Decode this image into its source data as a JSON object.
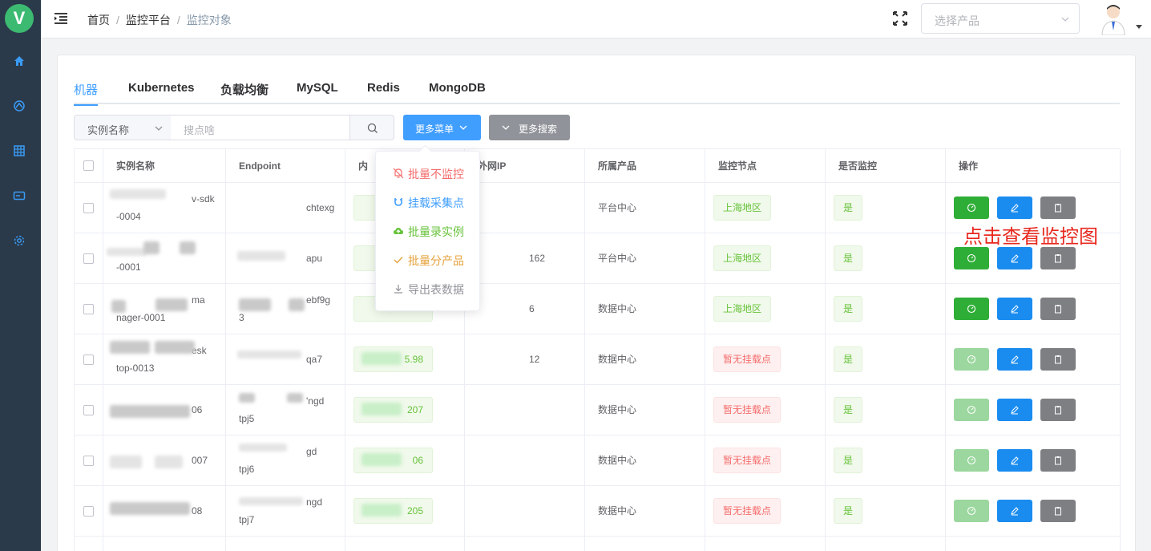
{
  "logo": {
    "letter": "V"
  },
  "breadcrumb": [
    "首页",
    "监控平台",
    "监控对象"
  ],
  "product_select": {
    "placeholder": "选择产品"
  },
  "tabs": [
    "机器",
    "Kubernetes",
    "负载均衡",
    "MySQL",
    "Redis",
    "MongoDB"
  ],
  "search": {
    "field_label": "实例名称",
    "placeholder": "搜点啥"
  },
  "buttons": {
    "more_menu": "更多菜单",
    "more_search": "更多搜索"
  },
  "dropdown": [
    {
      "label": "批量不监控",
      "color": "#f56c6c"
    },
    {
      "label": "挂载采集点",
      "color": "#409eff"
    },
    {
      "label": "批量录实例",
      "color": "#67c23a"
    },
    {
      "label": "批量分产品",
      "color": "#e6a23c"
    },
    {
      "label": "导出表数据",
      "color": "#909399"
    }
  ],
  "table": {
    "headers": [
      "实例名称",
      "Endpoint",
      "内",
      "外网IP",
      "所属产品",
      "监控节点",
      "是否监控",
      "操作"
    ],
    "rows": [
      {
        "name1": "v-sdk",
        "name2": "-0004",
        "ep1": "chtexg",
        "ep2": "",
        "ip": "",
        "ext_ip": "",
        "product": "平台中心",
        "node": "上海地区",
        "node_ok": true,
        "monitored": "是",
        "view_enabled": true
      },
      {
        "name1": "",
        "name2": "-0001",
        "ep1": "apu",
        "ep2": "",
        "ip": "",
        "ext_ip": "162",
        "product": "平台中心",
        "node": "上海地区",
        "node_ok": true,
        "monitored": "是",
        "view_enabled": true
      },
      {
        "name1": "ma",
        "name2": "nager-0001",
        "ep1": "ebf9g",
        "ep2": "3",
        "ip": "",
        "ext_ip": "6",
        "product": "数据中心",
        "node": "上海地区",
        "node_ok": true,
        "monitored": "是",
        "view_enabled": true
      },
      {
        "name1": "esk",
        "name2": "top-0013",
        "ep1": "qa7",
        "ep2": "",
        "ip": "5.98",
        "ext_ip": "12",
        "product": "数据中心",
        "node": "暂无挂载点",
        "node_ok": false,
        "monitored": "是",
        "view_enabled": false
      },
      {
        "name1": "06",
        "name2": "",
        "ep1": "'ngd",
        "ep2": "tpj5",
        "ip": "207",
        "ext_ip": "",
        "product": "数据中心",
        "node": "暂无挂载点",
        "node_ok": false,
        "monitored": "是",
        "view_enabled": false
      },
      {
        "name1": "007",
        "name2": "",
        "ep1": "gd",
        "ep2": "tpj6",
        "ip": "06",
        "ext_ip": "",
        "product": "数据中心",
        "node": "暂无挂载点",
        "node_ok": false,
        "monitored": "是",
        "view_enabled": false
      },
      {
        "name1": "08",
        "name2": "",
        "ep1": "ngd",
        "ep2": "tpj7",
        "ip": "205",
        "ext_ip": "",
        "product": "数据中心",
        "node": "暂无挂载点",
        "node_ok": false,
        "monitored": "是",
        "view_enabled": false
      }
    ]
  },
  "annotation": "点击查看监控图"
}
